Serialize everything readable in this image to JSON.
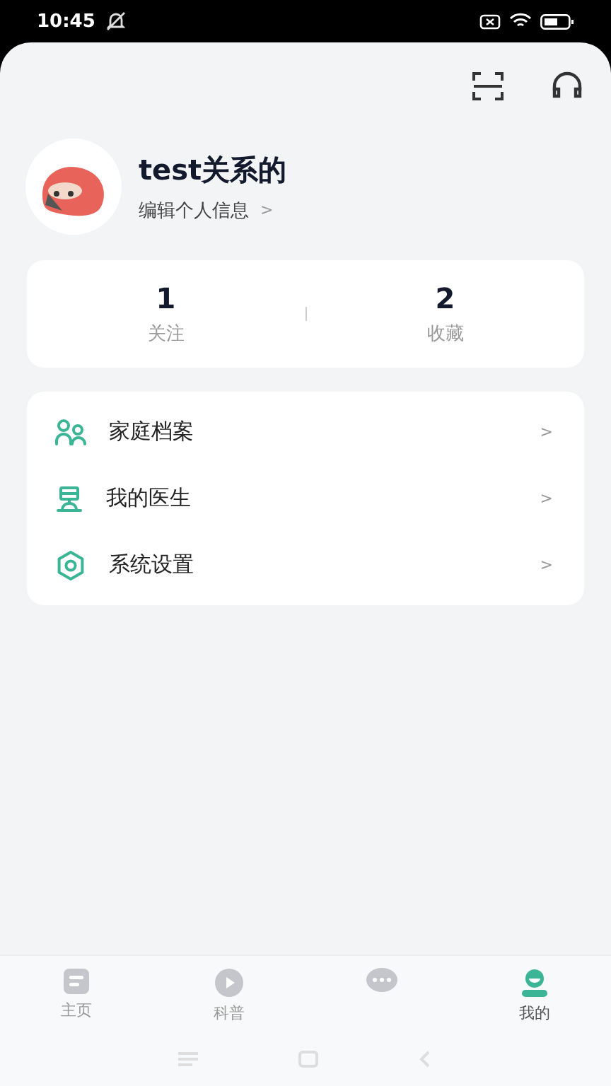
{
  "status_bar": {
    "time": "10:45"
  },
  "profile": {
    "name": "test关系的",
    "edit_link": "编辑个人信息",
    "edit_arrow": ">"
  },
  "stats": [
    {
      "value": "1",
      "label": "关注"
    },
    {
      "value": "2",
      "label": "收藏"
    }
  ],
  "menu": [
    {
      "kind": "family",
      "label": "家庭档案",
      "arrow": ">"
    },
    {
      "kind": "doctor",
      "label": "我的医生",
      "arrow": ">"
    },
    {
      "kind": "settings",
      "label": "系统设置",
      "arrow": ">"
    }
  ],
  "tabs": [
    {
      "kind": "home",
      "label": "主页",
      "selected": false
    },
    {
      "kind": "science",
      "label": "科普",
      "selected": false
    },
    {
      "kind": "chat",
      "selected": false
    },
    {
      "kind": "me",
      "label": "我的",
      "selected": true
    }
  ]
}
